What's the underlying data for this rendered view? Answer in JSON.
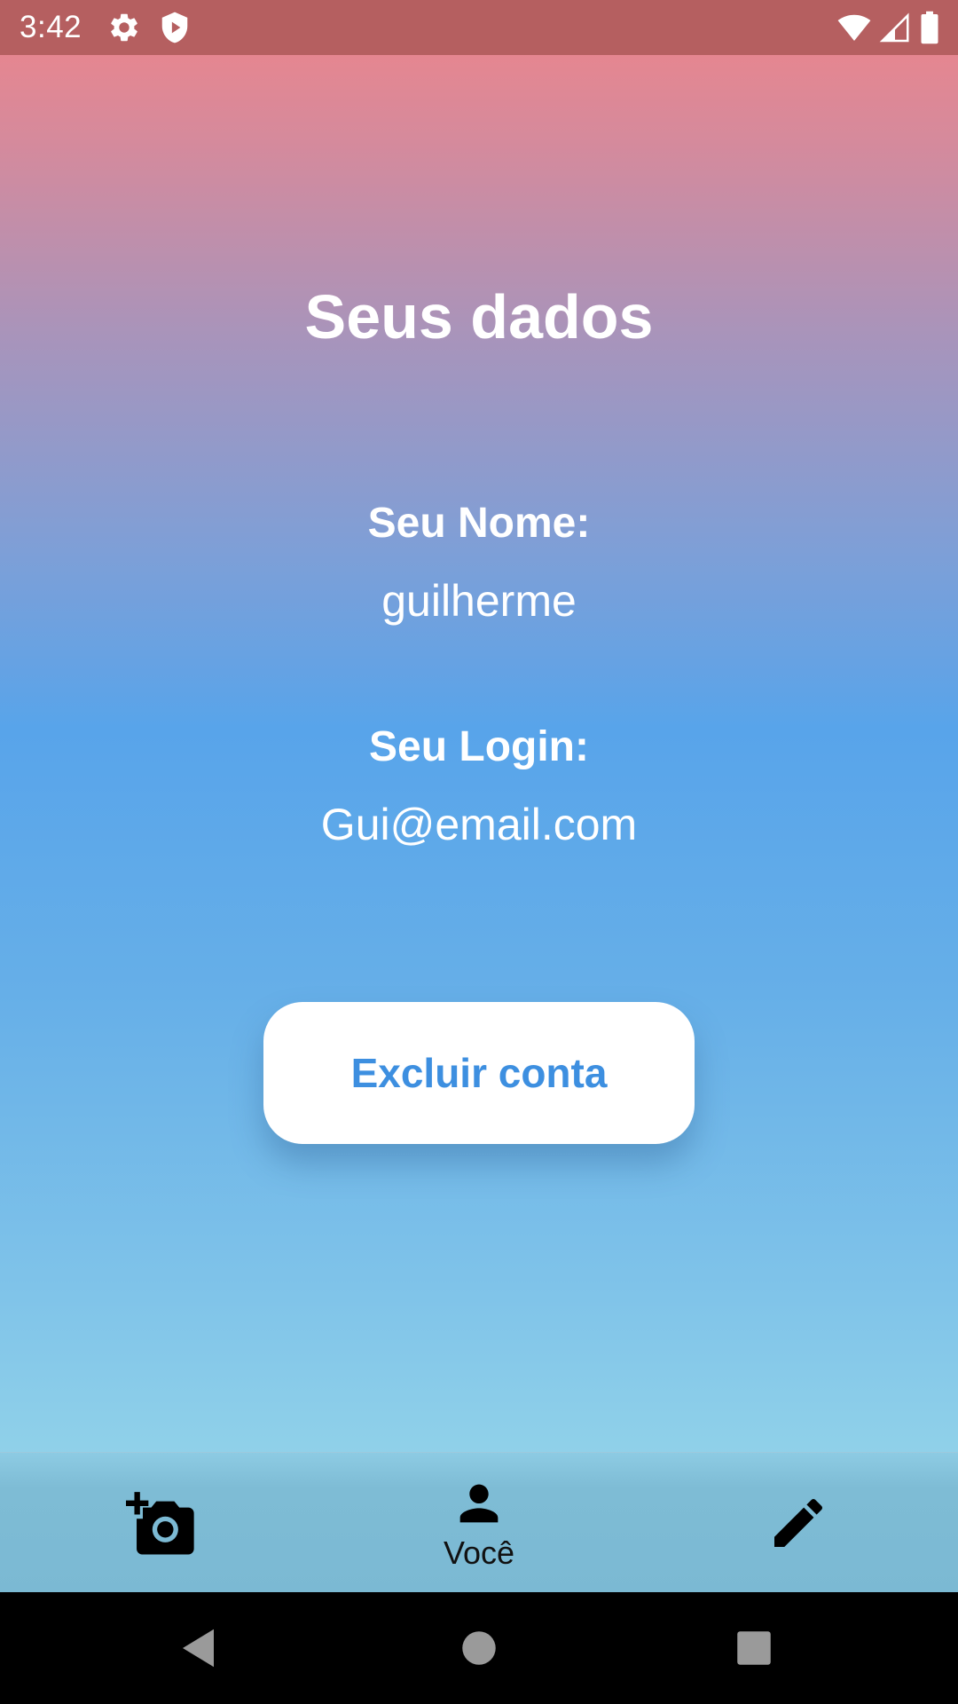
{
  "status_bar": {
    "time": "3:42",
    "icons": [
      "settings-gear-icon",
      "shield-play-icon",
      "wifi-icon",
      "cell-signal-icon",
      "battery-icon"
    ]
  },
  "page": {
    "title": "Seus dados"
  },
  "profile": {
    "name_label": "Seu Nome:",
    "name_value": "guilherme",
    "login_label": "Seu Login:",
    "login_value": "Gui@email.com"
  },
  "actions": {
    "delete_account_label": "Excluir conta"
  },
  "bottom_nav": {
    "items": [
      {
        "icon": "add-photo-icon",
        "label": ""
      },
      {
        "icon": "person-icon",
        "label": "Você"
      },
      {
        "icon": "pencil-edit-icon",
        "label": ""
      }
    ]
  },
  "system_nav": {
    "buttons": [
      "back-icon",
      "home-icon",
      "recents-icon"
    ]
  },
  "colors": {
    "status_bar": "#b55f60",
    "gradient_top": "#ef8489",
    "gradient_mid": "#58a4ea",
    "gradient_bottom": "#92d3e9",
    "button_background": "#ffffff",
    "button_text": "#3d8fe0",
    "text": "#ffffff",
    "nav_background": "#7bb9d3"
  }
}
